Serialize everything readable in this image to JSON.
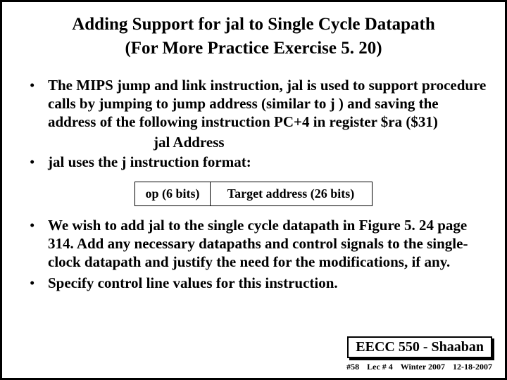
{
  "title_line1": "Adding Support for jal to Single Cycle Datapath",
  "title_line2": "(For More Practice Exercise 5. 20)",
  "bullet1": "The MIPS jump and link instruction,  jal  is used to support procedure calls by jumping to jump address  (similar to j ) and saving the address of the following instruction PC+4  in register $ra  ($31)",
  "jal_syntax": "jal   Address",
  "bullet2": "jal  uses the  j  instruction format:",
  "format_op": "op (6 bits)",
  "format_target": "Target address (26 bits)",
  "bullet3": "We wish to add  jal to the single cycle datapath in Figure 5. 24 page 314.  Add any necessary datapaths and control signals to the single-clock datapath and justify the need for the modifications, if any.",
  "bullet4": "Specify control line values for this instruction.",
  "footer_course": "EECC 550 - Shaaban",
  "footer_slide": "#58",
  "footer_lec": "Lec # 4",
  "footer_term": "Winter 2007",
  "footer_date": "12-18-2007"
}
